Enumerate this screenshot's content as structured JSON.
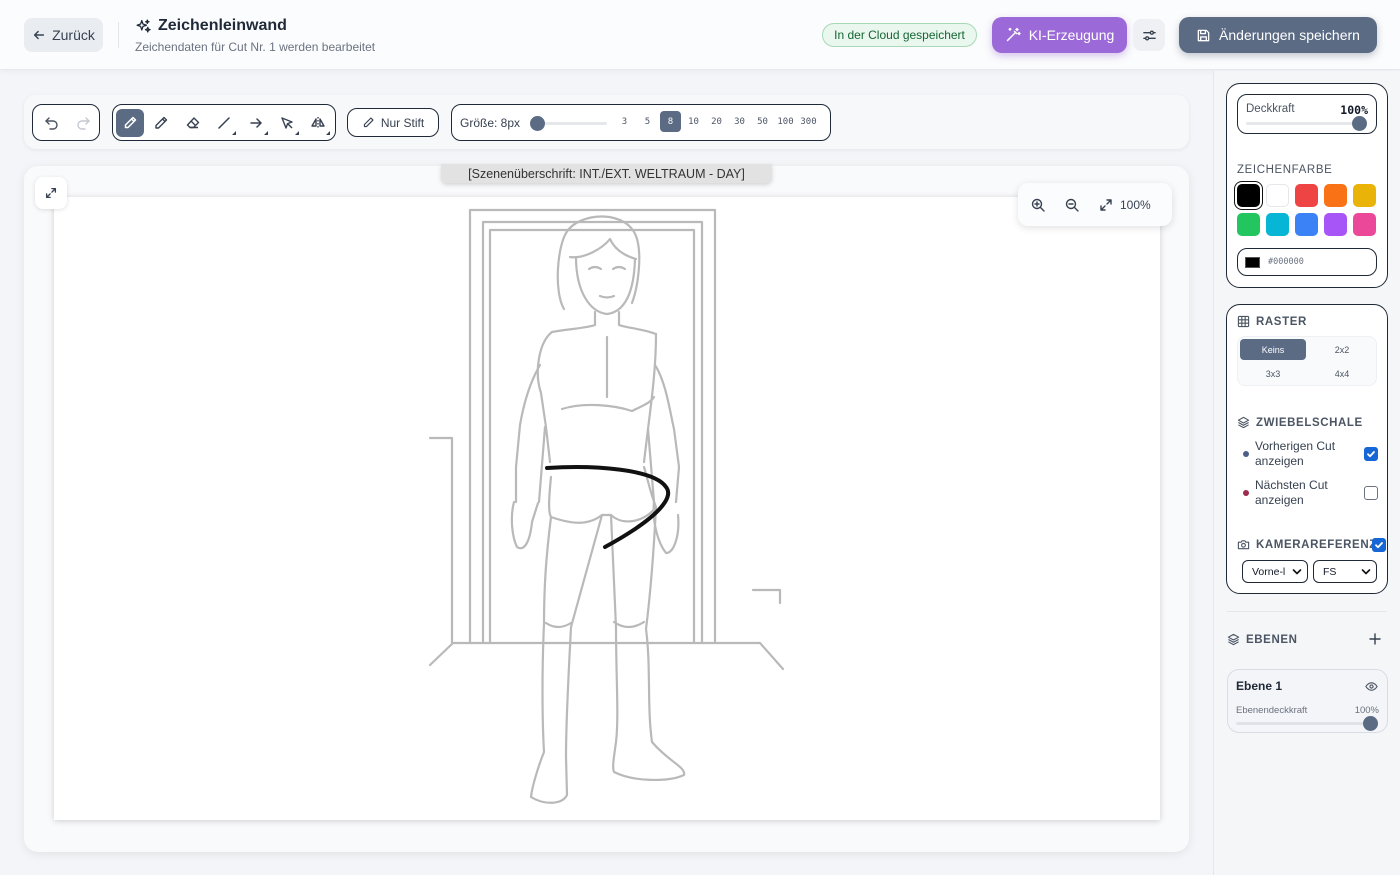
{
  "header": {
    "back_label": "Zurück",
    "title": "Zeichenleinwand",
    "subtitle": "Zeichendaten für Cut Nr. 1 werden bearbeitet",
    "cloud_status": "In der Cloud gespeichert",
    "ai_label": "KI-Erzeugung",
    "save_label": "Änderungen speichern",
    "colors": {
      "ai": "#9b6ad8",
      "save": "#5b6b84",
      "cloud_bg": "#eaf7ee"
    }
  },
  "toolbar": {
    "pen_only_label": "Nur Stift",
    "size_label": "Größe: 8px",
    "size_value": 8,
    "size_presets": [
      "3",
      "5",
      "8",
      "10",
      "20",
      "30",
      "50",
      "100",
      "300"
    ],
    "active_preset": "8",
    "active_tool": "brush"
  },
  "canvas": {
    "scene_heading": "[Szenenüberschrift: INT./EXT. WELTRAUM - DAY]",
    "zoom_level": "100%"
  },
  "panel": {
    "opacity_label": "Deckkraft",
    "opacity_value": "100%",
    "color_section": "ZEICHENFARBE",
    "swatches": [
      "#000000",
      "#ffffff",
      "#ef4444",
      "#f97316",
      "#eab308",
      "#22c55e",
      "#06b6d4",
      "#3b82f6",
      "#a855f7",
      "#ec4899"
    ],
    "hex_value": "#000000",
    "grid_section": "RASTER",
    "grid_options": [
      "Keins",
      "2x2",
      "3x3",
      "4x4"
    ],
    "grid_active": "Keins",
    "onion_section": "ZWIEBELSCHALE",
    "onion_prev": "Vorherigen Cut anzeigen",
    "onion_next": "Nächsten Cut anzeigen",
    "onion_prev_checked": true,
    "onion_next_checked": false,
    "camera_section": "KAMERAREFERENZ",
    "camera_checked": true,
    "camera_angle": "Vorne-l",
    "camera_shot": "FS",
    "layers_section": "EBENEN",
    "layer_name": "Ebene 1",
    "layer_opacity_label": "Ebenendeckkraft",
    "layer_opacity_value": "100%"
  }
}
